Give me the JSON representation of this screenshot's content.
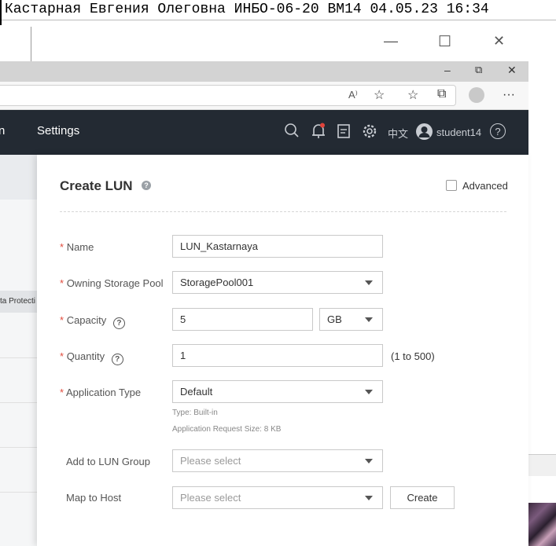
{
  "caption": "Кастарная Евгения Олеговна ИНБО-06-20 ВМ14 04.05.23 16:34",
  "window_controls": {
    "minimize": "—",
    "maximize": "☐",
    "close": "✕"
  },
  "browser_controls": {
    "minimize": "–",
    "restore": "⧉",
    "close": "✕"
  },
  "browser_toolbar": {
    "read_aloud": "A⁾",
    "more": "···"
  },
  "header": {
    "left_fragment": "n",
    "settings": "Settings",
    "language": "中文",
    "username": "student14",
    "help": "?"
  },
  "left_panel": {
    "protection_fragment": "ta Protecti"
  },
  "dialog": {
    "title": "Create LUN",
    "help_mark": "?",
    "advanced_label": "Advanced",
    "required_mark": "*",
    "fields": {
      "name": {
        "label": "Name",
        "value": "LUN_Kastarnaya"
      },
      "pool": {
        "label": "Owning Storage Pool",
        "value": "StoragePool001"
      },
      "capacity": {
        "label": "Capacity",
        "value": "5",
        "unit": "GB"
      },
      "quantity": {
        "label": "Quantity",
        "value": "1",
        "range": "(1 to 500)"
      },
      "app_type": {
        "label": "Application Type",
        "value": "Default",
        "hint_type": "Type: Built-in",
        "hint_size": "Application Request Size: 8 KB"
      },
      "lun_group": {
        "label": "Add to LUN Group",
        "placeholder": "Please select"
      },
      "host": {
        "label": "Map to Host",
        "placeholder": "Please select"
      }
    },
    "create_button": "Create"
  }
}
